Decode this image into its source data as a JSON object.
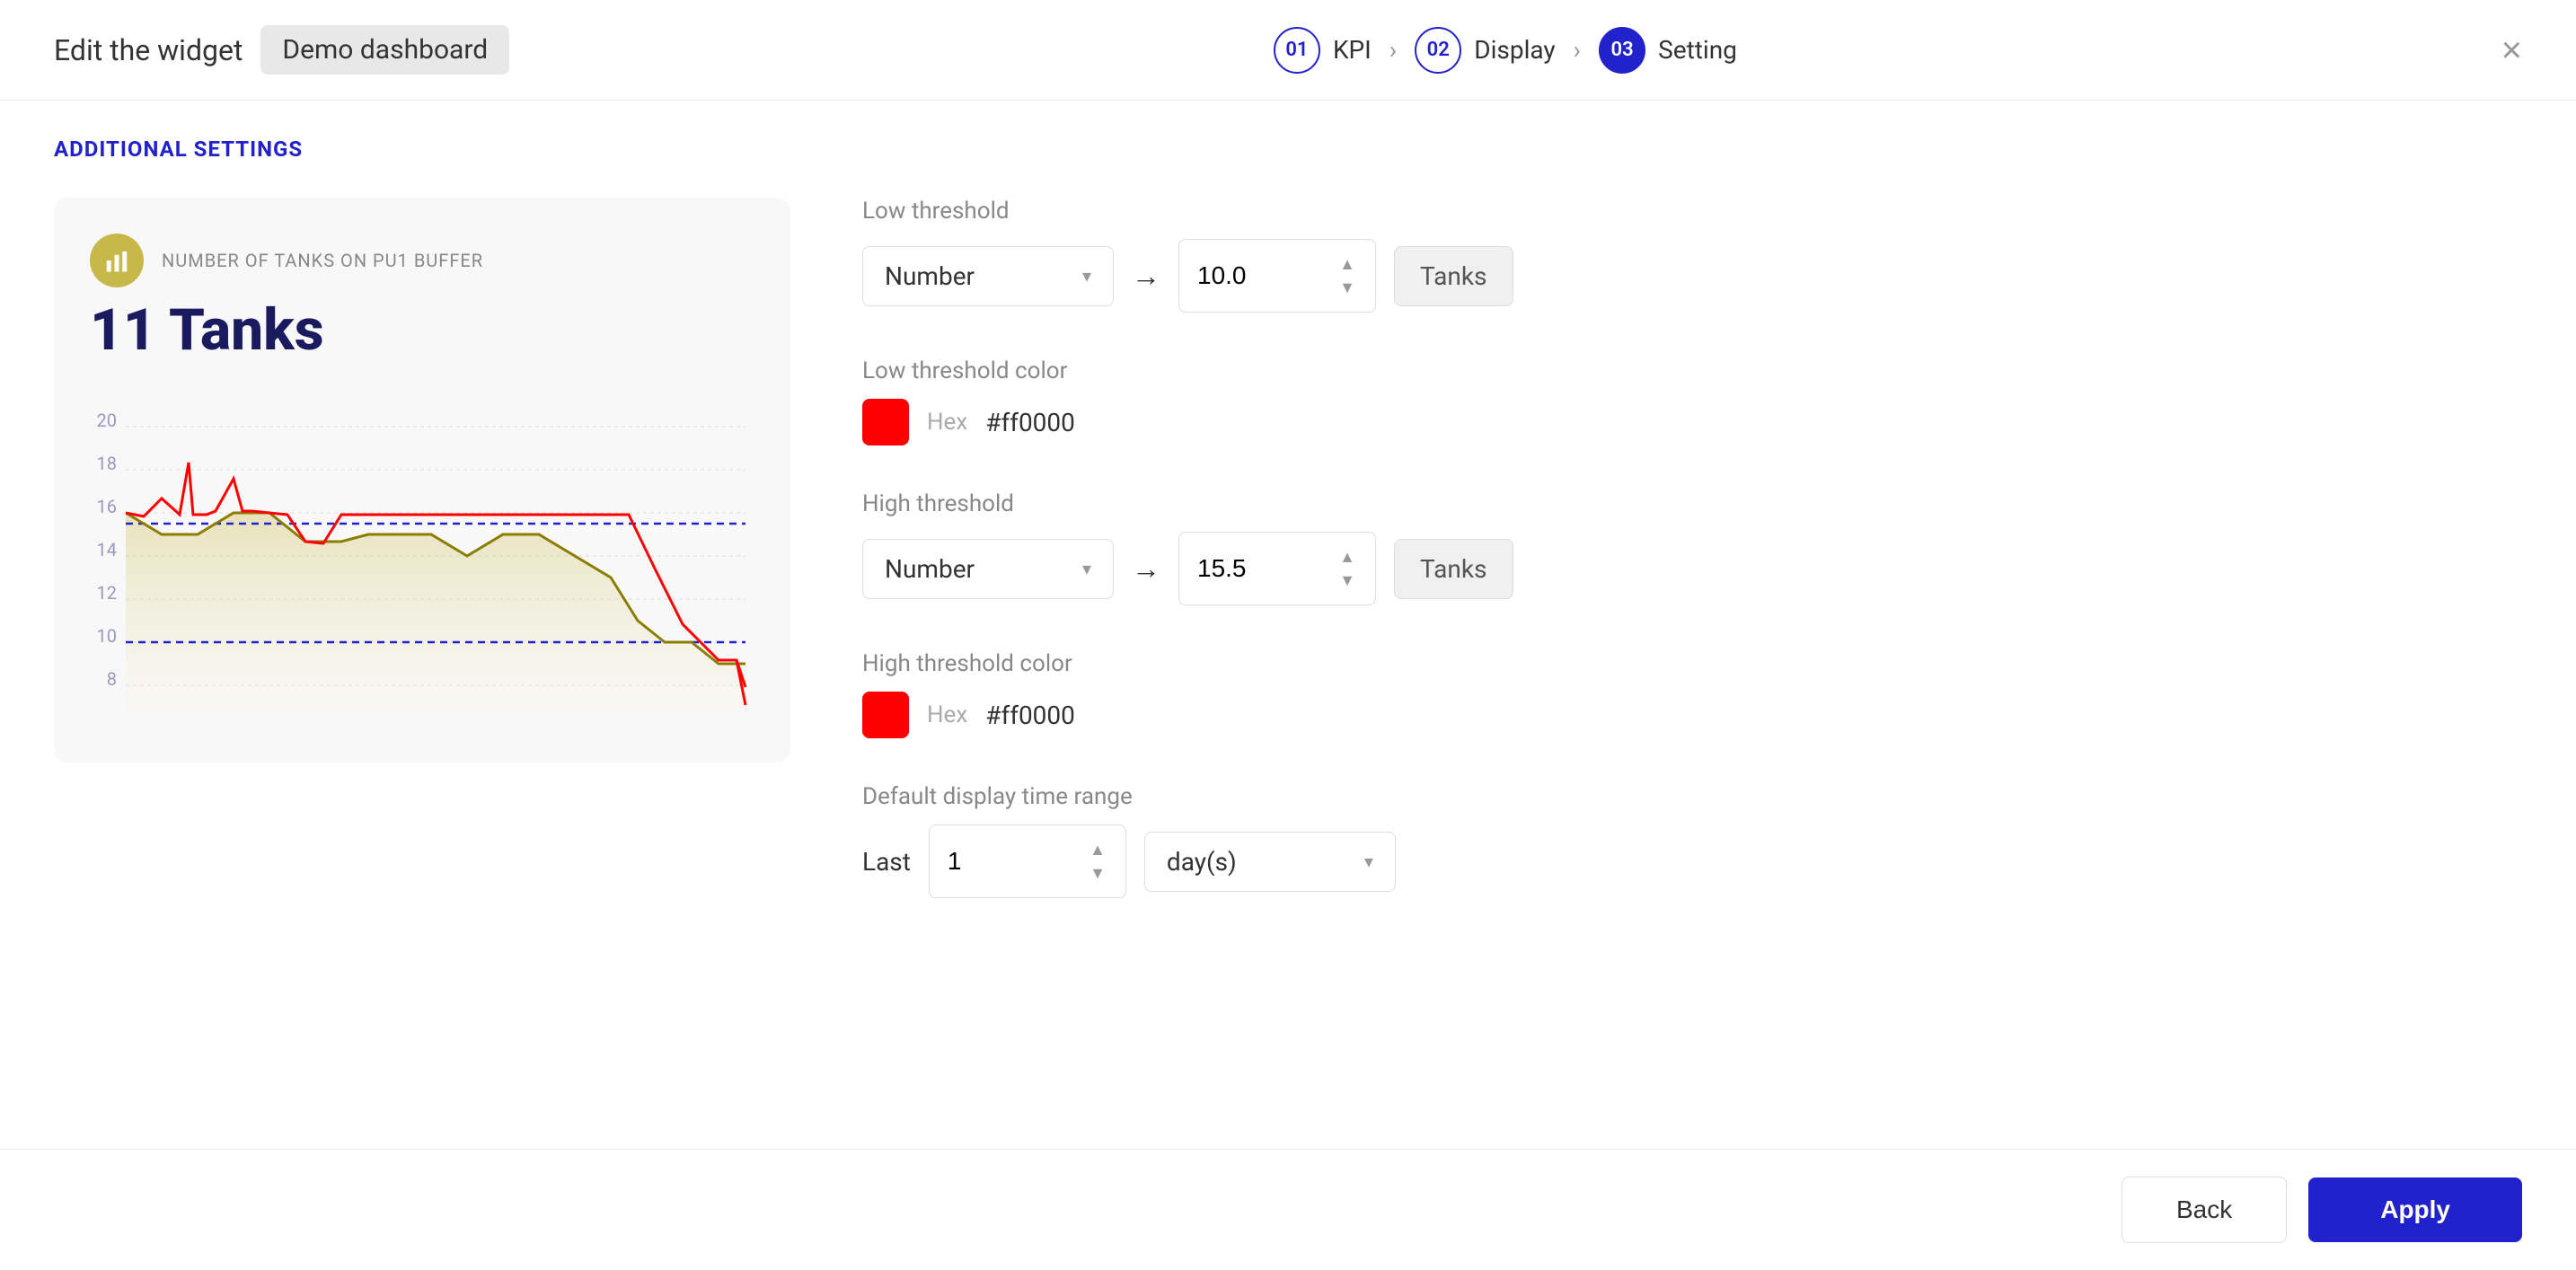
{
  "header": {
    "edit_label": "Edit the widget",
    "dashboard_name": "Demo dashboard",
    "close_icon": "×",
    "steps": [
      {
        "number": "01",
        "label": "KPI",
        "active": false
      },
      {
        "number": "02",
        "label": "Display",
        "active": false
      },
      {
        "number": "03",
        "label": "Setting",
        "active": true
      }
    ]
  },
  "section": {
    "title": "ADDITIONAL SETTINGS"
  },
  "chart": {
    "subtitle": "NUMBER OF TANKS ON PU1 BUFFER",
    "value": "11 Tanks",
    "y_labels": [
      "20",
      "18",
      "16",
      "14",
      "12",
      "10",
      "8"
    ]
  },
  "settings": {
    "low_threshold": {
      "label": "Low threshold",
      "type_label": "Number",
      "value": "10.0",
      "unit": "Tanks"
    },
    "low_threshold_color": {
      "label": "Low threshold color",
      "hex_label": "Hex",
      "hex_value": "#ff0000"
    },
    "high_threshold": {
      "label": "High threshold",
      "type_label": "Number",
      "value": "15.5",
      "unit": "Tanks"
    },
    "high_threshold_color": {
      "label": "High threshold color",
      "hex_label": "Hex",
      "hex_value": "#ff0000"
    },
    "time_range": {
      "label": "Default display time range",
      "last_label": "Last",
      "value": "1",
      "unit": "day(s)"
    }
  },
  "footer": {
    "back_label": "Back",
    "apply_label": "Apply"
  }
}
